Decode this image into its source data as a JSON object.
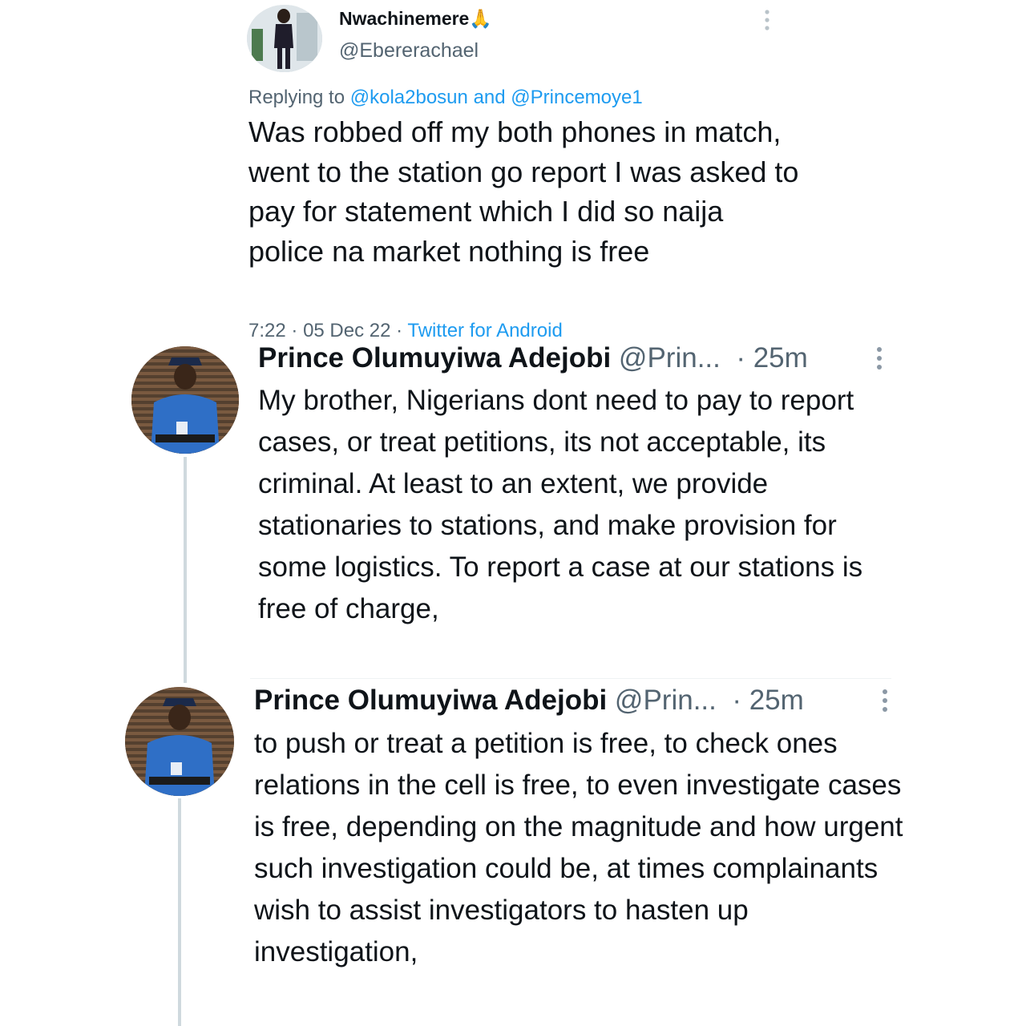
{
  "tweet": {
    "display_name": "Nwachinemere",
    "name_emoji": "🙏",
    "handle": "@Ebererachael",
    "replying_prefix": "Replying to",
    "replying_to_1": "@kola2bosun",
    "replying_and": "and",
    "replying_to_2": "@Princemoye1",
    "text": "Was robbed off my both phones in match, went to the station go report I was asked to pay for statement which I did so naija police na market nothing is free",
    "time": "7:22",
    "sep1": "·",
    "date": "05 Dec 22",
    "sep2": "·",
    "source": "Twitter for Android",
    "more_icon": "more-vertical-icon"
  },
  "replies": [
    {
      "display_name": "Prince Olumuyiwa Adejobi",
      "handle": "@Prin...",
      "time": "· 25m",
      "text": "My brother, Nigerians dont need to pay to report cases, or treat petitions, its not acceptable, its criminal. At least to an extent, we provide stationaries to stations, and make provision for some logistics. To report a case at our stations is free of charge,",
      "more_icon": "more-vertical-icon"
    },
    {
      "display_name": "Prince Olumuyiwa Adejobi",
      "handle": "@Prin...",
      "time": "· 25m",
      "text": "to push or treat a petition is free, to check ones relations in the cell is free, to even investigate cases is free, depending on the magnitude and how urgent such investigation could be, at times complainants wish to assist investigators to hasten up investigation,",
      "more_icon": "more-vertical-icon"
    }
  ],
  "colors": {
    "text": "#0f1419",
    "secondary": "#536471",
    "link": "#1d9bf0",
    "thread_line": "#cfd9de",
    "police_uniform": "#2f6fc6"
  }
}
